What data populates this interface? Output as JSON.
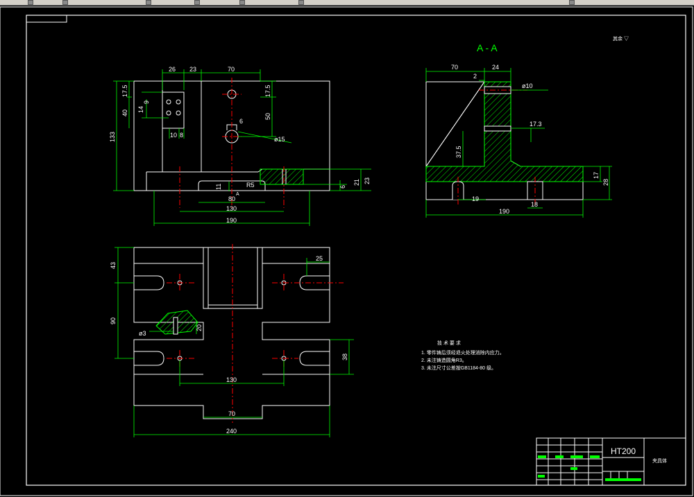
{
  "colors": {
    "background": "#000000",
    "outline": "#ffffff",
    "dimension": "#00ff00",
    "centerline": "#ff0000",
    "hatch": "#00ff00"
  },
  "section": {
    "label": "A - A"
  },
  "surface_note": {
    "text": "其余 ▽"
  },
  "technical_requirements": {
    "heading": "技 术 要 求",
    "items": [
      "1. 零件铸后须经退火处理消除内应力。",
      "2. 未注铸造圆角R3。",
      "3. 未注尺寸公差按GB1184-80 级。"
    ]
  },
  "title_block": {
    "material": "HT200",
    "part_name": "夹具体"
  },
  "front_view": {
    "dims_top": [
      "26",
      "23",
      "70"
    ],
    "dims_left": [
      "17.5",
      "40",
      "133",
      "14",
      "9"
    ],
    "dims_right": [
      "17.5",
      "50",
      "21",
      "23",
      "6"
    ],
    "dims_inner": [
      "6",
      "10",
      "8",
      "11",
      "R5",
      "A"
    ],
    "diameter": "ø15",
    "dims_bottom": [
      "80",
      "130",
      "190"
    ]
  },
  "section_view": {
    "dims_top": [
      "70",
      "24",
      "2"
    ],
    "diameter": "ø10",
    "dims_right": [
      "17.3",
      "17",
      "28"
    ],
    "dim_height": "37.5",
    "dims_bottom": [
      "18",
      "19",
      "190"
    ]
  },
  "top_view": {
    "dims_left": [
      "43",
      "90"
    ],
    "dims_right": [
      "25",
      "38"
    ],
    "diameter": "ø3",
    "dim_small": "20",
    "dims_bottom": [
      "130",
      "70",
      "240"
    ]
  }
}
